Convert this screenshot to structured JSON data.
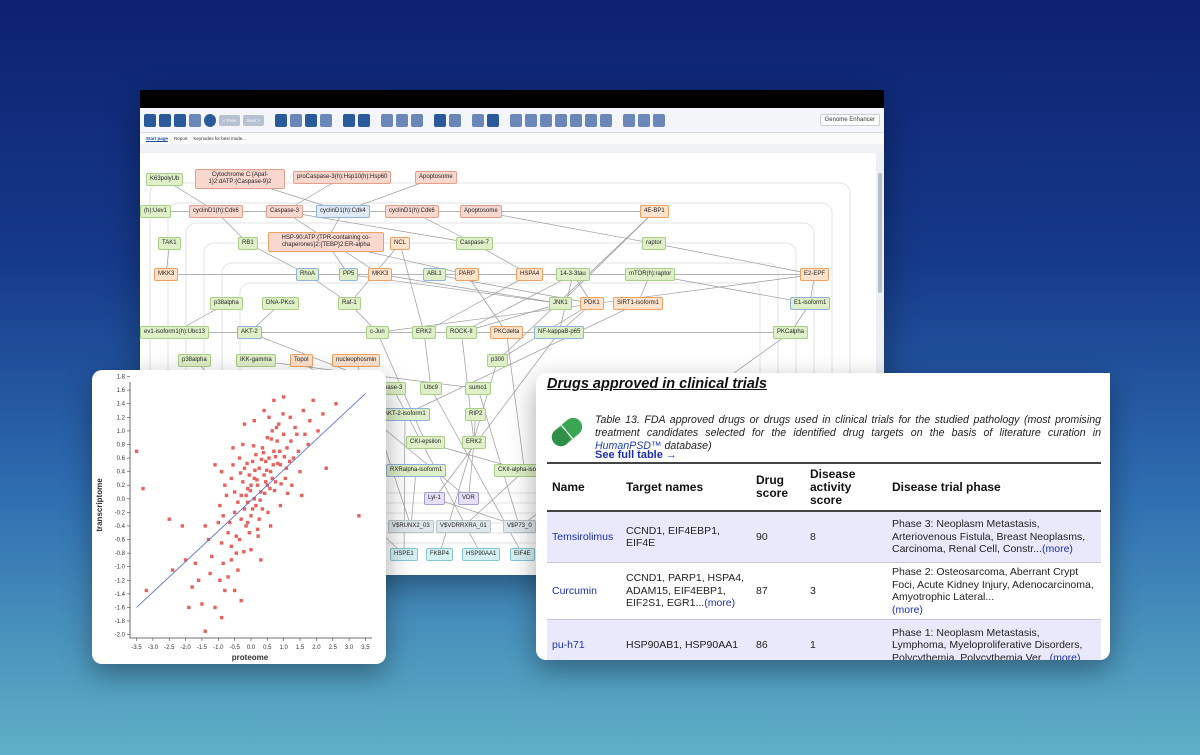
{
  "app": {
    "toolbar": {
      "prev_label": "< Prev",
      "next_label": "Next >",
      "genome_enhancer": "Genome Enhancer"
    },
    "tabs": [
      "Start page",
      "Report",
      "Keynodes for best mode..."
    ],
    "nodes": [
      {
        "id": "n1",
        "label": "K63polyUb",
        "style": "g"
      },
      {
        "id": "n2",
        "label": "Cytochrome C:{Apaf-1}2:dATP:{Caspase-9}2",
        "style": "r"
      },
      {
        "id": "n3",
        "label": "proCaspase-3(h):Hsp10(h):Hsp60",
        "style": "r"
      },
      {
        "id": "n4",
        "label": "Apoptosome",
        "style": "r"
      },
      {
        "id": "n5",
        "label": "(h):Uev1",
        "style": "g"
      },
      {
        "id": "n6",
        "label": "cyclinD1(h):Cdk6",
        "style": "r"
      },
      {
        "id": "n7",
        "label": "Caspase-3",
        "style": "r"
      },
      {
        "id": "n8",
        "label": "cyclinD1(h):Cdk4",
        "style": "b"
      },
      {
        "id": "n9",
        "label": "cyclinD1(h):Cdk6",
        "style": "r"
      },
      {
        "id": "n10",
        "label": "Apoptosome",
        "style": "r"
      },
      {
        "id": "n11",
        "label": "4E-BP1",
        "style": "o"
      },
      {
        "id": "n12",
        "label": "TAK1",
        "style": "g"
      },
      {
        "id": "n13",
        "label": "RB1",
        "style": "g"
      },
      {
        "id": "n14",
        "label": "HSP-90:ATP:{TPR-containing co-chaperones}2:{TEBP}2:ER-alpha",
        "style": "ro"
      },
      {
        "id": "n15",
        "label": "NCL",
        "style": "o"
      },
      {
        "id": "n16",
        "label": "Caspase-7",
        "style": "g"
      },
      {
        "id": "n17",
        "label": "raptor",
        "style": "g"
      },
      {
        "id": "n18",
        "label": "MKK3",
        "style": "o"
      },
      {
        "id": "n19",
        "label": "RhoA",
        "style": "gb"
      },
      {
        "id": "n20",
        "label": "PP5",
        "style": "gb"
      },
      {
        "id": "n21",
        "label": "MKK3",
        "style": "o"
      },
      {
        "id": "n22",
        "label": "ABL1",
        "style": "gb"
      },
      {
        "id": "n23",
        "label": "PARP",
        "style": "o"
      },
      {
        "id": "n24",
        "label": "HSPA4",
        "style": "o"
      },
      {
        "id": "n25",
        "label": "14-3-3tau",
        "style": "g"
      },
      {
        "id": "n26",
        "label": "mTOR(h):raptor",
        "style": "g"
      },
      {
        "id": "n27",
        "label": "E2-EPF",
        "style": "o"
      },
      {
        "id": "n28",
        "label": "p38alpha",
        "style": "g"
      },
      {
        "id": "n29",
        "label": "DNA-PKcs",
        "style": "g"
      },
      {
        "id": "n30",
        "label": "Raf-1",
        "style": "g"
      },
      {
        "id": "n31",
        "label": "JNK1",
        "style": "g"
      },
      {
        "id": "n32",
        "label": "PDK1",
        "style": "o"
      },
      {
        "id": "n33",
        "label": "SIRT1-isoform1",
        "style": "o"
      },
      {
        "id": "n34",
        "label": "E1-isoform1",
        "style": "gb"
      },
      {
        "id": "n35",
        "label": "ev1-isoform1(h):Ubc13",
        "style": "g"
      },
      {
        "id": "n36",
        "label": "AKT-2",
        "style": "gb"
      },
      {
        "id": "n37",
        "label": "c-Jun",
        "style": "g"
      },
      {
        "id": "n38",
        "label": "ERK2",
        "style": "g"
      },
      {
        "id": "n39",
        "label": "ROCK-II",
        "style": "g"
      },
      {
        "id": "n40",
        "label": "PKCdelta",
        "style": "o"
      },
      {
        "id": "n41",
        "label": "NF-kappaB-p65",
        "style": "gb"
      },
      {
        "id": "n42",
        "label": "PKCalpha",
        "style": "g"
      },
      {
        "id": "n43",
        "label": "p38alpha",
        "style": "g"
      },
      {
        "id": "n44",
        "label": "IKK-gamma",
        "style": "g"
      },
      {
        "id": "n45",
        "label": "TopoI",
        "style": "o"
      },
      {
        "id": "n46",
        "label": "nucleophosmin",
        "style": "o"
      },
      {
        "id": "n47",
        "label": "p300",
        "style": "g"
      },
      {
        "id": "n48",
        "label": "pase-3",
        "style": "g"
      },
      {
        "id": "n49",
        "label": "Ubc9",
        "style": "g"
      },
      {
        "id": "n50",
        "label": "sumo1",
        "style": "g"
      },
      {
        "id": "n51",
        "label": "AKT-2-isoform1",
        "style": "gb"
      },
      {
        "id": "n52",
        "label": "RIP2",
        "style": "g"
      },
      {
        "id": "n53",
        "label": "CKI-epsilon",
        "style": "g"
      },
      {
        "id": "n54",
        "label": "ERK2",
        "style": "g"
      },
      {
        "id": "n55",
        "label": "RXRalpha-isoform1",
        "style": "gb"
      },
      {
        "id": "n56",
        "label": "CKII-alpha-isoform1",
        "style": "g"
      },
      {
        "id": "n57",
        "label": "Lyl-1",
        "style": "lil"
      },
      {
        "id": "n58",
        "label": "VDR",
        "style": "lil"
      },
      {
        "id": "n59",
        "label": "V$RUNX2_03",
        "style": "gray"
      },
      {
        "id": "n60",
        "label": "V$VDRRXRA_01",
        "style": "gray"
      },
      {
        "id": "n61",
        "label": "V$P73_0",
        "style": "gray"
      },
      {
        "id": "n62",
        "label": "HSPE1",
        "style": "cy"
      },
      {
        "id": "n63",
        "label": "FKBP4",
        "style": "cy"
      },
      {
        "id": "n64",
        "label": "HSP90AA1",
        "style": "cy"
      },
      {
        "id": "n65",
        "label": "EIF4E",
        "style": "cy"
      }
    ]
  },
  "scatter": {
    "chart_data": {
      "type": "scatter",
      "xlabel": "proteome",
      "ylabel": "transcriptome",
      "xlim": [
        -3.7,
        3.7
      ],
      "ylim": [
        -2.05,
        1.72
      ],
      "xticks": [
        "-3.5",
        "-3.0",
        "-2.5",
        "-2.0",
        "-1.5",
        "-1.0",
        "-0.5",
        "0.0",
        "0.5",
        "1.0",
        "1.5",
        "2.0",
        "2.5",
        "3.0",
        "3.5"
      ],
      "yticks": [
        "-2.0",
        "-1.8",
        "-1.6",
        "-1.4",
        "-1.2",
        "-1.0",
        "-0.8",
        "-0.6",
        "-0.4",
        "-0.2",
        "0.0",
        "0.2",
        "0.4",
        "0.6",
        "0.8",
        "1.0",
        "1.2",
        "1.4",
        "1.6",
        "1.8"
      ],
      "point_color": "#e8615a",
      "fit_line_color": "#5a6fd8",
      "fit_line": [
        [
          -3.5,
          -1.6
        ],
        [
          3.5,
          1.55
        ]
      ],
      "points": [
        [
          -3.5,
          0.7
        ],
        [
          -3.3,
          0.15
        ],
        [
          -3.2,
          -1.35
        ],
        [
          -2.5,
          -0.3
        ],
        [
          -2.1,
          -0.4
        ],
        [
          -1.9,
          -1.6
        ],
        [
          -1.8,
          -1.3
        ],
        [
          -1.6,
          -1.2
        ],
        [
          -1.5,
          -1.55
        ],
        [
          -1.4,
          -1.95
        ],
        [
          -1.2,
          -0.85
        ],
        [
          -1.1,
          -1.6
        ],
        [
          -0.9,
          -1.75
        ],
        [
          -0.8,
          -1.35
        ],
        [
          -1.3,
          -0.6
        ],
        [
          -1.1,
          0.5
        ],
        [
          -0.95,
          -0.1
        ],
        [
          -0.85,
          -0.25
        ],
        [
          -0.7,
          -0.5
        ],
        [
          -0.6,
          0.3
        ],
        [
          -0.6,
          -0.9
        ],
        [
          -0.5,
          -0.2
        ],
        [
          -0.5,
          0.1
        ],
        [
          -0.45,
          -0.55
        ],
        [
          -0.4,
          -1.05
        ],
        [
          -0.35,
          0.6
        ],
        [
          -0.3,
          -0.3
        ],
        [
          -0.3,
          0.05
        ],
        [
          -0.25,
          0.25
        ],
        [
          -0.2,
          -0.15
        ],
        [
          -0.2,
          0.45
        ],
        [
          -0.15,
          -0.4
        ],
        [
          -0.1,
          0.15
        ],
        [
          -0.1,
          -0.05
        ],
        [
          -0.05,
          0.35
        ],
        [
          0.0,
          -0.25
        ],
        [
          0.0,
          0.2
        ],
        [
          0.05,
          0.55
        ],
        [
          0.1,
          0.0
        ],
        [
          0.1,
          0.3
        ],
        [
          0.15,
          -0.1
        ],
        [
          0.15,
          0.65
        ],
        [
          0.2,
          0.2
        ],
        [
          0.25,
          0.45
        ],
        [
          0.25,
          -0.3
        ],
        [
          0.3,
          0.1
        ],
        [
          0.35,
          0.75
        ],
        [
          0.4,
          0.35
        ],
        [
          0.45,
          0.55
        ],
        [
          0.5,
          0.2
        ],
        [
          0.5,
          0.9
        ],
        [
          0.55,
          0.6
        ],
        [
          0.6,
          0.4
        ],
        [
          0.65,
          1.0
        ],
        [
          0.7,
          0.7
        ],
        [
          0.75,
          0.25
        ],
        [
          0.8,
          0.85
        ],
        [
          0.85,
          1.1
        ],
        [
          0.9,
          0.5
        ],
        [
          1.0,
          0.95
        ],
        [
          1.05,
          0.3
        ],
        [
          1.1,
          0.75
        ],
        [
          1.2,
          1.2
        ],
        [
          1.3,
          0.6
        ],
        [
          1.4,
          0.95
        ],
        [
          1.5,
          0.4
        ],
        [
          1.6,
          1.3
        ],
        [
          1.75,
          0.8
        ],
        [
          1.9,
          1.45
        ],
        [
          2.05,
          1.0
        ],
        [
          2.3,
          0.45
        ],
        [
          2.6,
          1.4
        ],
        [
          3.3,
          -0.25
        ],
        [
          -0.75,
          0.05
        ],
        [
          -0.65,
          -0.35
        ],
        [
          -0.55,
          0.5
        ],
        [
          -0.45,
          -0.8
        ],
        [
          -0.35,
          -0.6
        ],
        [
          -0.25,
          0.8
        ],
        [
          -0.15,
          0.05
        ],
        [
          -0.05,
          -0.5
        ],
        [
          0.05,
          -0.15
        ],
        [
          0.12,
          0.42
        ],
        [
          0.22,
          -0.55
        ],
        [
          0.32,
          0.58
        ],
        [
          0.42,
          0.08
        ],
        [
          0.52,
          -0.2
        ],
        [
          0.62,
          0.88
        ],
        [
          0.72,
          0.12
        ],
        [
          0.82,
          0.52
        ],
        [
          0.92,
          0.22
        ],
        [
          1.02,
          0.62
        ],
        [
          1.12,
          0.08
        ],
        [
          1.22,
          0.85
        ],
        [
          -1.0,
          -0.35
        ],
        [
          -0.9,
          -0.65
        ],
        [
          -0.8,
          0.2
        ],
        [
          -0.7,
          -1.15
        ],
        [
          -0.6,
          -0.7
        ],
        [
          -0.4,
          -0.05
        ],
        [
          -0.32,
          0.38
        ],
        [
          -0.22,
          -0.78
        ],
        [
          -0.12,
          0.52
        ],
        [
          -0.02,
          0.12
        ],
        [
          0.08,
          0.78
        ],
        [
          0.18,
          0.28
        ],
        [
          0.28,
          -0.02
        ],
        [
          0.38,
          0.68
        ],
        [
          0.48,
          0.42
        ],
        [
          0.58,
          0.15
        ],
        [
          0.68,
          0.5
        ],
        [
          0.78,
          1.05
        ],
        [
          0.88,
          0.7
        ],
        [
          0.98,
          1.25
        ],
        [
          1.08,
          0.45
        ],
        [
          1.18,
          0.55
        ],
        [
          1.35,
          1.05
        ],
        [
          1.45,
          0.7
        ],
        [
          1.65,
          0.95
        ],
        [
          -2.4,
          -1.05
        ],
        [
          -2.0,
          -0.9
        ],
        [
          -1.7,
          -0.95
        ],
        [
          -1.4,
          -0.4
        ],
        [
          -1.25,
          -1.1
        ],
        [
          -0.95,
          -1.2
        ],
        [
          -0.85,
          -0.95
        ],
        [
          -0.5,
          -1.35
        ],
        [
          -0.3,
          -1.5
        ],
        [
          0.0,
          -0.75
        ],
        [
          0.3,
          -0.9
        ],
        [
          0.6,
          -0.4
        ],
        [
          0.9,
          -0.1
        ],
        [
          1.25,
          0.2
        ],
        [
          1.55,
          0.05
        ],
        [
          1.8,
          1.15
        ],
        [
          2.2,
          1.25
        ],
        [
          -0.2,
          1.1
        ],
        [
          0.1,
          1.15
        ],
        [
          0.4,
          1.3
        ],
        [
          0.7,
          1.45
        ],
        [
          1.0,
          1.5
        ],
        [
          0.55,
          1.2
        ],
        [
          -0.55,
          0.75
        ],
        [
          -0.9,
          0.4
        ],
        [
          0.2,
          -0.45
        ],
        [
          -0.1,
          -0.35
        ],
        [
          0.35,
          -0.15
        ],
        [
          0.45,
          0.25
        ],
        [
          0.65,
          0.3
        ],
        [
          0.75,
          0.62
        ]
      ]
    }
  },
  "drugs": {
    "heading": "Drugs approved in clinical trials",
    "caption_prefix": "Table 13. FDA approved drugs or drugs used in clinical trials for the studied pathology (most promising treatment candidates selected for the identified drug targets on the basis of literature curation in ",
    "caption_link": "HumanPSD™",
    "caption_suffix": " database)",
    "see_full": "See full table  →",
    "columns": [
      "Name",
      "Target names",
      "Drug score",
      "Disease activity score",
      "Disease trial phase"
    ],
    "rows": [
      {
        "name": "Temsirolimus",
        "targets": "CCND1, EIF4EBP1, EIF4E",
        "targets_more": "",
        "drug_score": "90",
        "activity_score": "8",
        "phase": "Phase 3: Neoplasm Metastasis, Arteriovenous Fistula, Breast Neoplasms, Carcinoma, Renal Cell, Constr...",
        "phase_more": "(more)"
      },
      {
        "name": "Curcumin",
        "targets": "CCND1, PARP1, HSPA4, ADAM15, EIF4EBP1, EIF2S1, EGR1...",
        "targets_more": "(more)",
        "drug_score": "87",
        "activity_score": "3",
        "phase": "Phase 2: Osteosarcoma, Aberrant Crypt Foci, Acute Kidney Injury, Adenocarcinoma, Amyotrophic Lateral...",
        "phase_more": "(more)"
      },
      {
        "name": "pu-h71",
        "targets": "HSP90AB1, HSP90AA1",
        "targets_more": "",
        "drug_score": "86",
        "activity_score": "1",
        "phase": "Phase 1: Neoplasm Metastasis, Lymphoma, Myeloproliferative Disorders, Polycythemia, Polycythemia Ver...",
        "phase_more": "(more)"
      }
    ]
  }
}
